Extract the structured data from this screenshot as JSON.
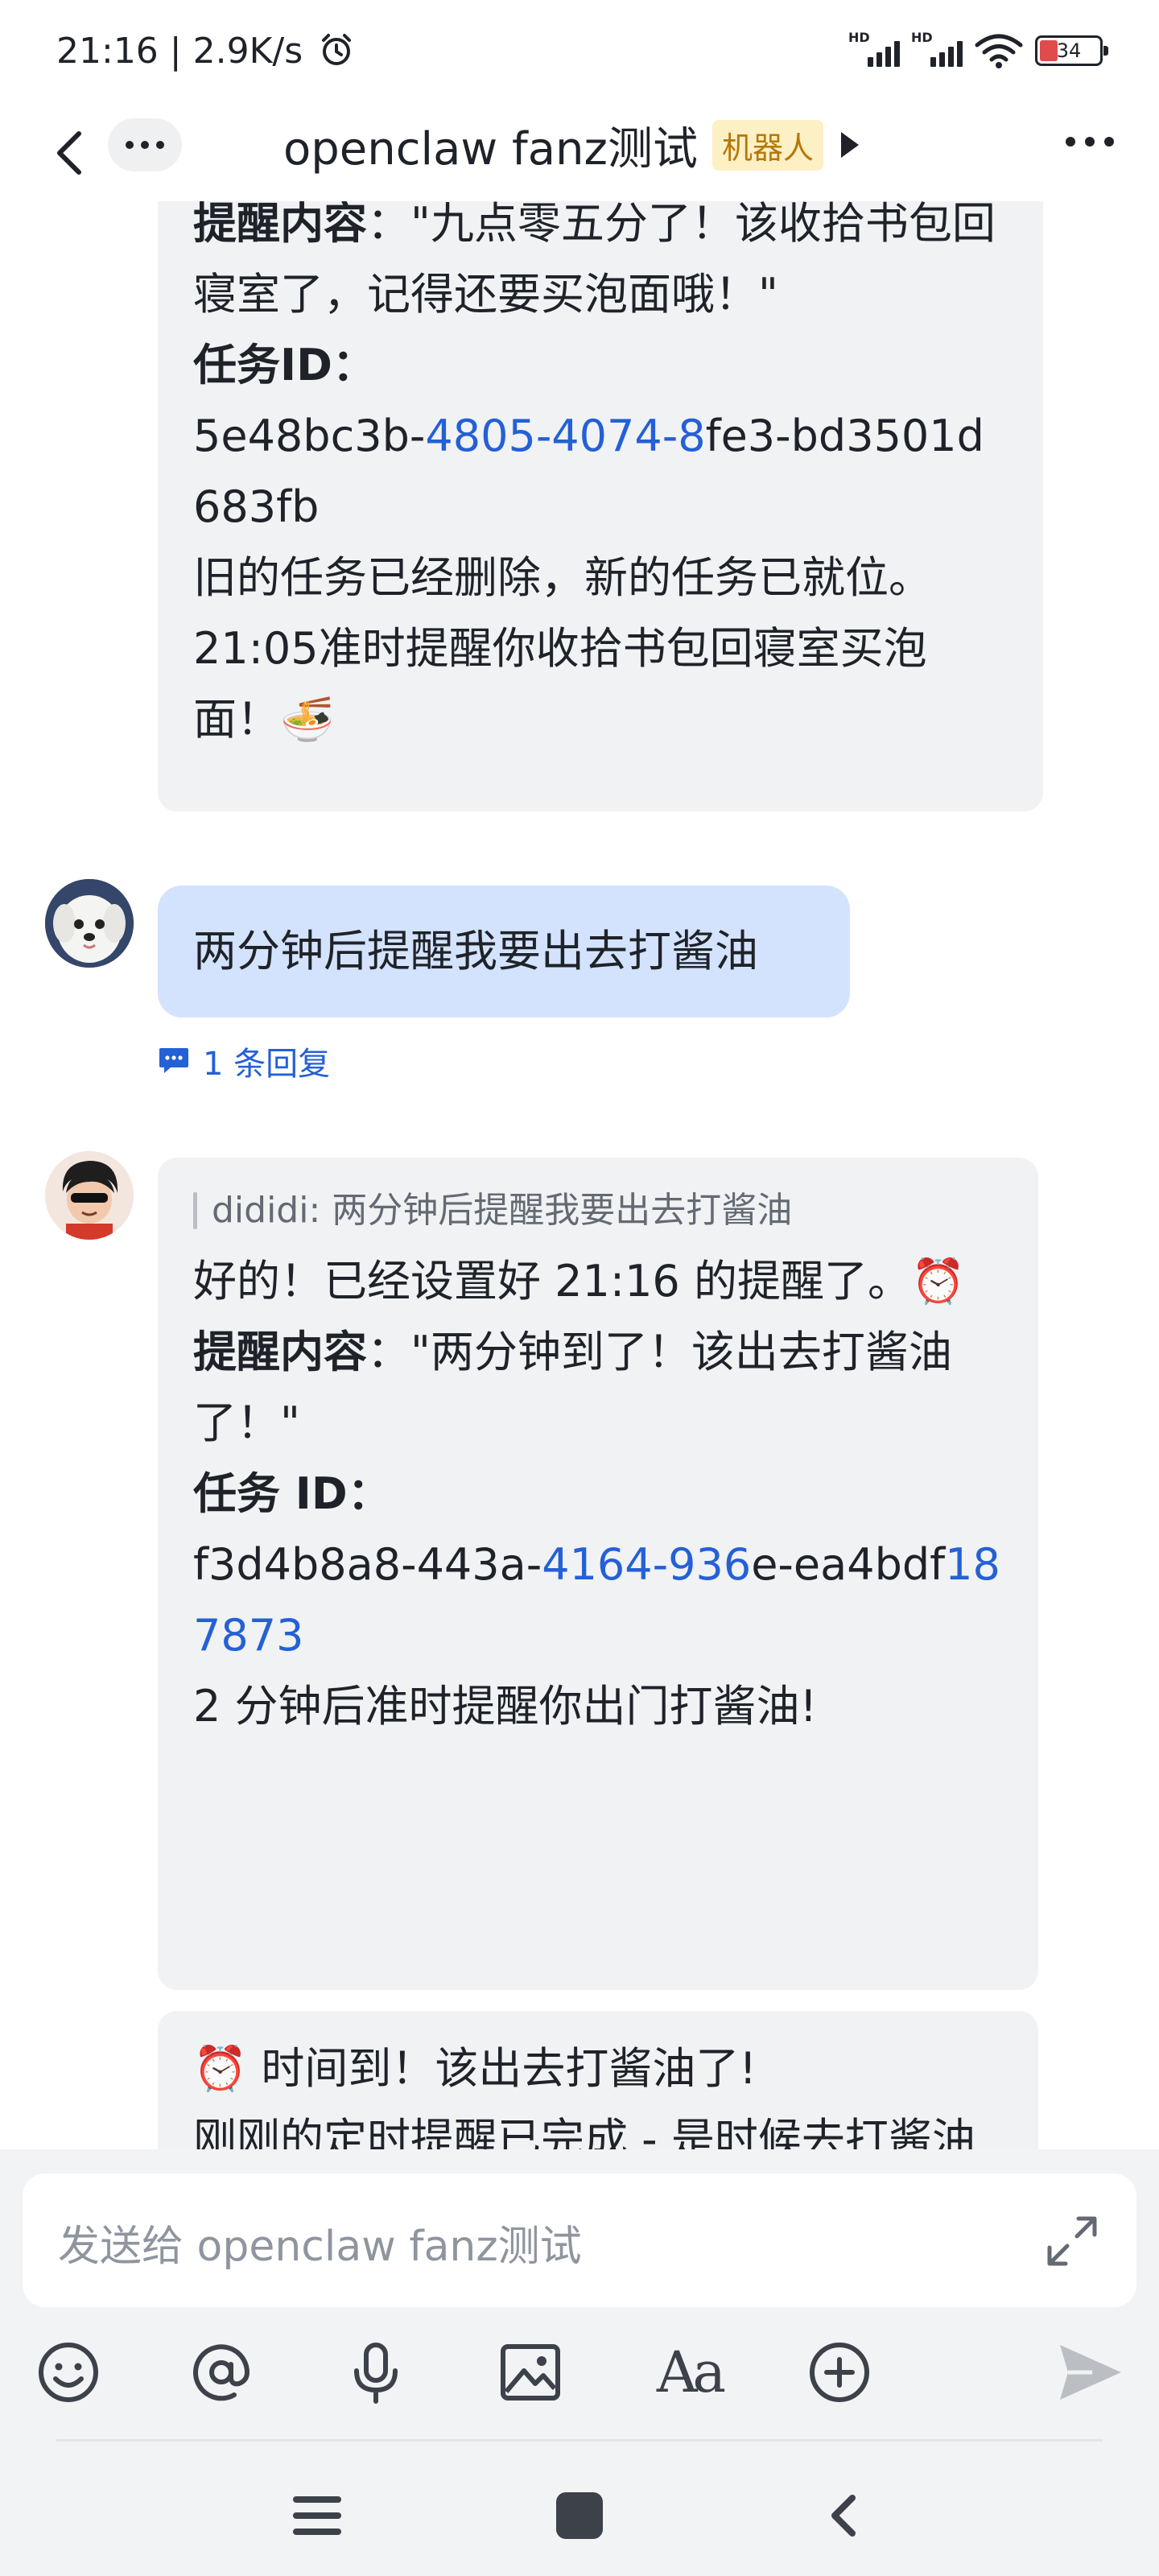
{
  "status_bar": {
    "time_and_speed": "21:16 | 2.9K/s",
    "battery_level": "34"
  },
  "nav": {
    "title": "openclaw fanz测试",
    "badge": "机器人"
  },
  "messages": [
    {
      "sender": "bot",
      "parts": {
        "label_content": "提醒内容",
        "content_text": "：\"九点零五分了！该收拾书包回寝室了，记得还要买泡面哦！\"",
        "label_id": "任务ID",
        "id_colon": "：",
        "id_part1": "5e48bc3b-",
        "id_link": "4805-4074-8",
        "id_part2": "fe3-bd3501d683fb",
        "line_1": "旧的任务已经删除，新的任务已就位。",
        "line_2": "21:05准时提醒你收拾书包回寝室买泡面！🍜"
      }
    },
    {
      "sender": "user",
      "text": "两分钟后提醒我要出去打酱油",
      "reply_count": "1 条回复"
    },
    {
      "sender": "bot",
      "quote": "dididi: 两分钟后提醒我要出去打酱油",
      "parts": {
        "line_1": "好的！已经设置好 21:16 的提醒了。⏰",
        "label_content": "提醒内容",
        "content_text": "：\"两分钟到了！该出去打酱油了！\"",
        "label_id": "任务 ID",
        "id_colon": "：",
        "id_part1": "f3d4b8a8-443a-",
        "id_link1": "4164-936",
        "id_part2": "e-ea4bdf",
        "id_link2": "187873",
        "line_2": "2 分钟后准时提醒你出门打酱油!"
      }
    },
    {
      "sender": "bot",
      "parts": {
        "line_1": "⏰ 时间到！该出去打酱油了!",
        "line_2": "刚刚的定时提醒已完成 - 是时候去打酱油了！🥢"
      }
    }
  ],
  "composer": {
    "placeholder": "发送给 openclaw fanz测试",
    "format_label": "Aa"
  },
  "colors": {
    "link": "#2460d6",
    "user_bubble": "#d4e3fd",
    "bot_bubble": "#f1f2f4",
    "badge_bg": "#fdf0c4",
    "badge_text": "#b7780a"
  }
}
